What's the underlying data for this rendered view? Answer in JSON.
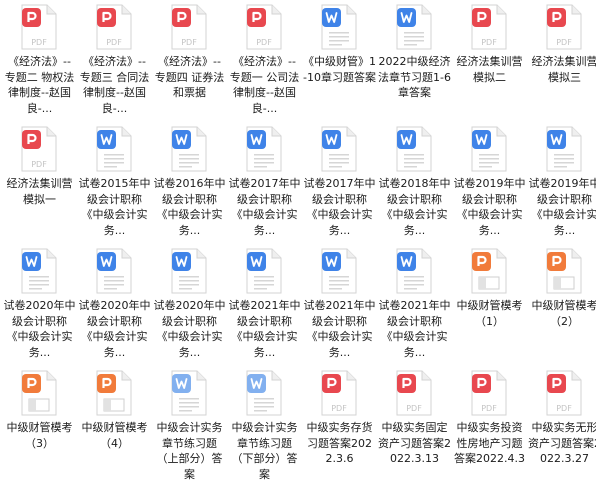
{
  "folder": {
    "items": [
      {
        "type": "pdf",
        "label": "《经济法》--专题二 物权法律制度--赵国良-..."
      },
      {
        "type": "pdf",
        "label": "《经济法》--专题三 合同法律制度--赵国良-..."
      },
      {
        "type": "pdf",
        "label": "《经济法》--专题四 证券法和票据"
      },
      {
        "type": "pdf",
        "label": "《经济法》--专题一 公司法律制度--赵国良-..."
      },
      {
        "type": "word",
        "label": "《中级财管》1-10章习题答案"
      },
      {
        "type": "word",
        "label": "2022中级经济法章节习题1-6章答案"
      },
      {
        "type": "pdf",
        "label": "经济法集训营模拟二"
      },
      {
        "type": "pdf",
        "label": "经济法集训营模拟三"
      },
      {
        "type": "pdf",
        "label": "经济法集训营模拟一"
      },
      {
        "type": "word",
        "label": "试卷2015年中级会计职称《中级会计实务..."
      },
      {
        "type": "word",
        "label": "试卷2016年中级会计职称《中级会计实务..."
      },
      {
        "type": "word",
        "label": "试卷2017年中级会计职称《中级会计实务..."
      },
      {
        "type": "word",
        "label": "试卷2017年中级会计职称《中级会计实务..."
      },
      {
        "type": "word",
        "label": "试卷2018年中级会计职称《中级会计实务..."
      },
      {
        "type": "word",
        "label": "试卷2019年中级会计职称《中级会计实务..."
      },
      {
        "type": "word",
        "label": "试卷2019年中级会计职称《中级会计实务..."
      },
      {
        "type": "word",
        "label": "试卷2020年中级会计职称《中级会计实务..."
      },
      {
        "type": "word",
        "label": "试卷2020年中级会计职称《中级会计实务..."
      },
      {
        "type": "word",
        "label": "试卷2020年中级会计职称《中级会计实务..."
      },
      {
        "type": "word",
        "label": "试卷2021年中级会计职称《中级会计实务..."
      },
      {
        "type": "word",
        "label": "试卷2021年中级会计职称《中级会计实务..."
      },
      {
        "type": "word",
        "label": "试卷2021年中级会计职称《中级会计实务..."
      },
      {
        "type": "ppt",
        "label": "中级财管模考（1）"
      },
      {
        "type": "ppt",
        "label": "中级财管模考（2）"
      },
      {
        "type": "ppt",
        "label": "中级财管模考（3）"
      },
      {
        "type": "ppt",
        "label": "中级财管模考（4）"
      },
      {
        "type": "word-light",
        "label": "中级会计实务章节练习题（上部分）答案"
      },
      {
        "type": "word-light",
        "label": "中级会计实务章节练习题（下部分）答案"
      },
      {
        "type": "pdf",
        "label": "中级实务存货习题答案2022.3.6"
      },
      {
        "type": "pdf",
        "label": "中级实务固定资产习题答案2022.3.13"
      },
      {
        "type": "pdf",
        "label": "中级实务投资性房地产习题答案2022.4.3"
      },
      {
        "type": "pdf",
        "label": "中级实务无形资产习题答案2022.3.27"
      }
    ]
  },
  "icon_colors": {
    "pdf": "#e8484f",
    "word": "#3f83e8",
    "word-light": "#82b0ef",
    "ppt": "#f17b3b"
  },
  "icon_text": {
    "pdf": "PDF"
  }
}
